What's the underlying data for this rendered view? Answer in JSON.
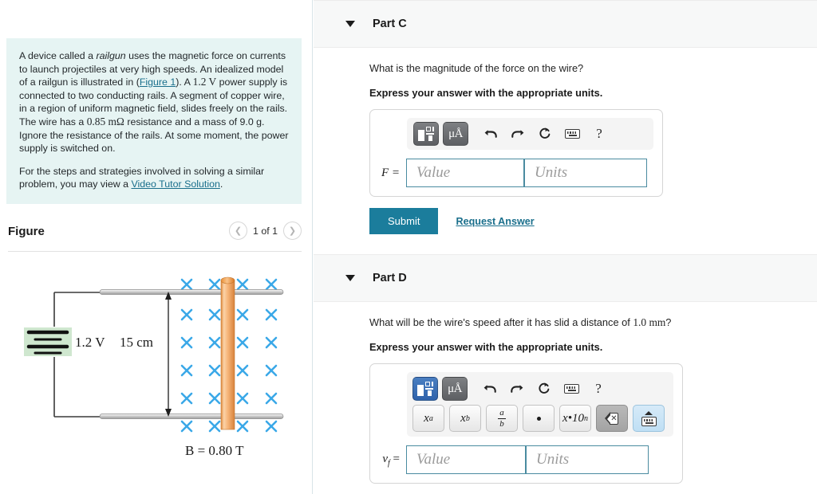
{
  "problem": {
    "para1_a": "A device called a ",
    "para1_italic": "railgun",
    "para1_b": " uses the magnetic force on currents to launch projectiles at very high speeds. An idealized model of a railgun is illustrated in (",
    "figure_link": "Figure 1",
    "para1_c": "). A ",
    "voltage": "1.2 V",
    "para1_d": " power supply is connected to two conducting rails. A segment of copper wire, in a region of uniform magnetic field, slides freely on the rails. The wire has a ",
    "resistance": "0.85 mΩ",
    "para1_e": " resistance and a mass of 9.0 g. Ignore the resistance of the rails. At some moment, the power supply is switched on.",
    "para2_a": "For the steps and strategies involved in solving a similar problem, you may view a ",
    "video_link": "Video Tutor Solution",
    "para2_b": "."
  },
  "figure": {
    "title": "Figure",
    "prev_icon": "chevron-left-icon",
    "next_icon": "chevron-right-icon",
    "counter": "1 of 1",
    "battery_label": "1.2 V",
    "length_label": "15 cm",
    "field_label": "B = 0.80 T",
    "field_mark": "✕",
    "field_rows": 6,
    "field_cols": 4,
    "field_color": "#3aa8e8",
    "rod_color": "#f0a96a",
    "battery_highlight": "#cfe7cf"
  },
  "partC": {
    "caret_icon": "caret-down-icon",
    "title": "Part C",
    "question": "What is the magnitude of the force on the wire?",
    "instruction": "Express your answer with the appropriate units.",
    "var_label": "F =",
    "value_placeholder": "Value",
    "units_placeholder": "Units",
    "toolbar": {
      "template_label": "template-tiles-icon",
      "units_label": "μÅ",
      "undo_icon": "undo-arrow-icon",
      "redo_icon": "redo-arrow-icon",
      "reset_icon": "reset-circle-icon",
      "keyboard_icon": "keyboard-icon",
      "help_label": "?"
    },
    "submit_label": "Submit",
    "request_label": "Request Answer",
    "accent_color": "#1b7d9c"
  },
  "partD": {
    "caret_icon": "caret-down-icon",
    "title": "Part D",
    "question_a": "What will be the wire's speed after it has slid a distance of ",
    "question_math": "1.0 mm",
    "question_b": "?",
    "instruction": "Express your answer with the appropriate units.",
    "var_label": "v",
    "var_sub": "f",
    "var_eq": "=",
    "value_placeholder": "Value",
    "units_placeholder": "Units",
    "toolbar": {
      "template_label": "template-tiles-icon",
      "units_label": "μÅ",
      "undo_icon": "undo-arrow-icon",
      "redo_icon": "redo-arrow-icon",
      "reset_icon": "reset-circle-icon",
      "keyboard_icon": "keyboard-icon",
      "help_label": "?",
      "superscript": "x",
      "superscript_exp": "a",
      "subscript": "x",
      "subscript_idx": "b",
      "fraction_num": "a",
      "fraction_den": "b",
      "multiply_dot": "•",
      "sci_notation": "x•10",
      "sci_notation_exp": "n",
      "backspace_icon": "backspace-icon",
      "keyboard_toggle_icon": "keyboard-up-icon"
    },
    "active_color": "#2f62ab"
  }
}
